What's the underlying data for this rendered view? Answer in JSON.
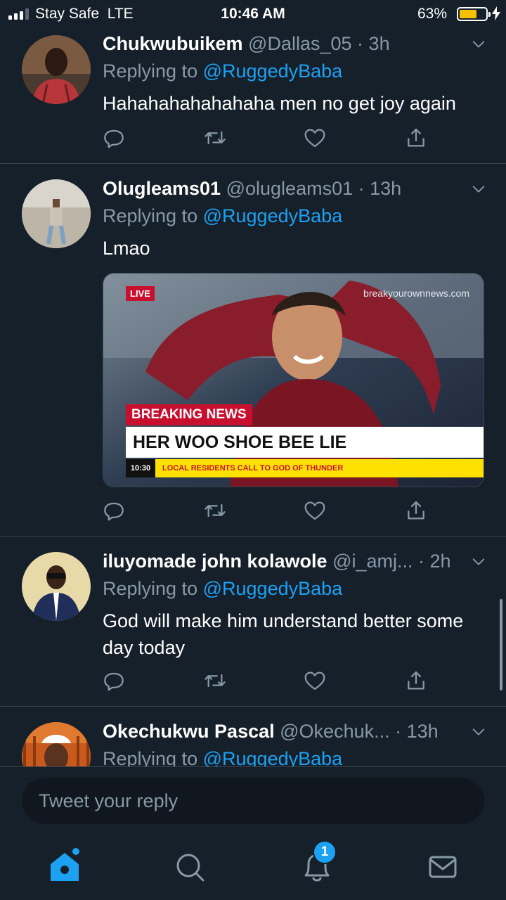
{
  "status_bar": {
    "carrier": "Stay Safe",
    "network": "LTE",
    "time": "10:46 AM",
    "battery": "63%",
    "battery_level": 0.63
  },
  "tweets": [
    {
      "name": "Chukwubuikem",
      "handle": "@Dallas_05",
      "time": "3h",
      "replying_prefix": "Replying to",
      "mention": "@RuggedyBaba",
      "text": "Hahahahahahahaha men no get joy again"
    },
    {
      "name": "Olugleams01",
      "handle": "@olugleams01",
      "time": "13h",
      "replying_prefix": "Replying to",
      "mention": "@RuggedyBaba",
      "text": "Lmao",
      "media": {
        "live": "LIVE",
        "watermark": "breakyourownnews.com",
        "tag": "BREAKING NEWS",
        "headline": "HER WOO SHOE BEE LIE",
        "ticker_time": "10:30",
        "ticker_text": "LOCAL RESIDENTS CALL TO GOD OF THUNDER"
      }
    },
    {
      "name": "iluyomade john kolawole",
      "handle": "@i_amj...",
      "time": "2h",
      "replying_prefix": "Replying to",
      "mention": "@RuggedyBaba",
      "text": "God will make him understand better some day today"
    },
    {
      "name": "Okechukwu Pascal",
      "handle": "@Okechuk...",
      "time": "13h",
      "replying_prefix": "Replying to",
      "mention": "@RuggedyBaba"
    }
  ],
  "composer": {
    "placeholder": "Tweet your reply"
  },
  "tabbar": {
    "notifications_count": "1"
  },
  "icons": {
    "action_row": [
      "reply-icon",
      "retweet-icon",
      "like-icon",
      "share-icon"
    ],
    "tabs": [
      "home-icon",
      "search-icon",
      "notifications-icon",
      "messages-icon"
    ]
  },
  "colors": {
    "background": "#15202b",
    "accent": "#1da1f2",
    "muted": "#8899a6",
    "divider": "#38444d"
  }
}
